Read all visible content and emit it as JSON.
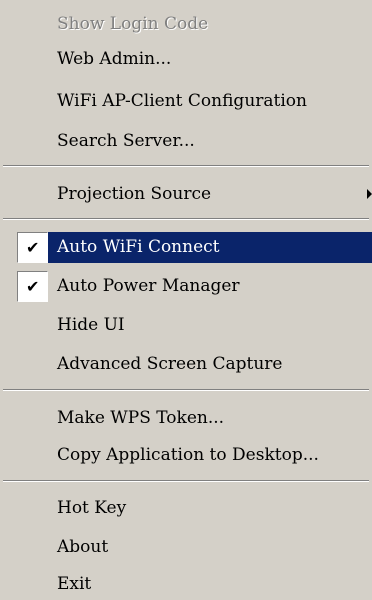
{
  "menu": {
    "items": [
      {
        "label": "Show Login Code"
      },
      {
        "label": "Web Admin..."
      },
      {
        "label": "WiFi AP-Client Configuration"
      },
      {
        "label": "Search Server..."
      },
      {
        "label": "Projection Source"
      },
      {
        "label": "Auto WiFi Connect"
      },
      {
        "label": "Auto Power Manager"
      },
      {
        "label": "Hide UI"
      },
      {
        "label": "Advanced Screen Capture"
      },
      {
        "label": "Make WPS Token..."
      },
      {
        "label": "Copy Application to Desktop..."
      },
      {
        "label": "Hot Key"
      },
      {
        "label": "About"
      },
      {
        "label": "Exit"
      }
    ],
    "checkmark_glyph": "✔",
    "highlight_color": "#0a246a",
    "background_color": "#d4d0c8",
    "disabled_text_color": "#808080"
  }
}
